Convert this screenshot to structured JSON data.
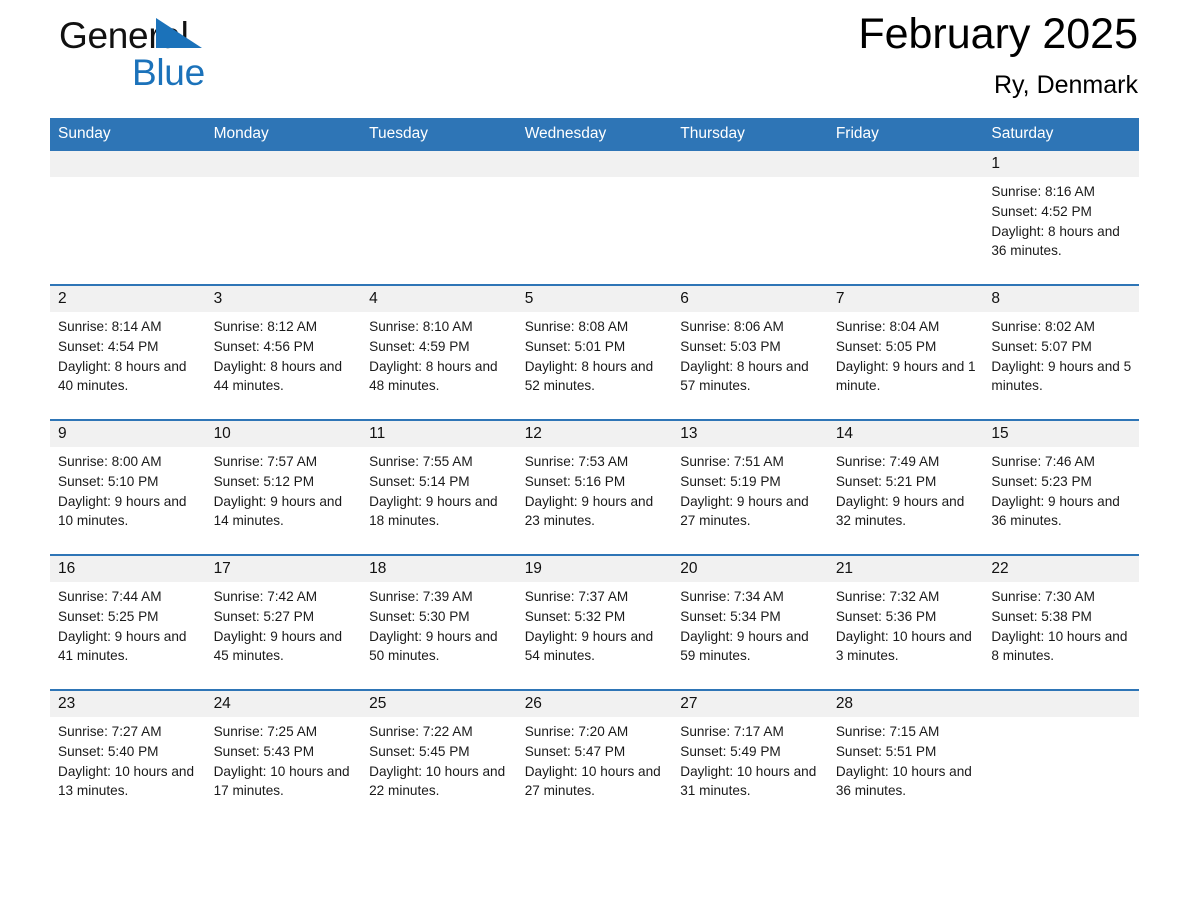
{
  "brand": {
    "name_part1": "General",
    "name_part2": "Blue",
    "accent_color": "#1b72ba"
  },
  "header": {
    "title": "February 2025",
    "subtitle": "Ry, Denmark"
  },
  "theme": {
    "header_blue": "#2e75b6",
    "daynum_band": "#f1f1f1",
    "row_border": "#2e75b6"
  },
  "weekdays": [
    "Sunday",
    "Monday",
    "Tuesday",
    "Wednesday",
    "Thursday",
    "Friday",
    "Saturday"
  ],
  "labels": {
    "sunrise_prefix": "Sunrise:",
    "sunset_prefix": "Sunset:",
    "daylight_prefix": "Daylight:"
  },
  "weeks": [
    [
      {
        "day": "",
        "sunrise": "",
        "sunset": "",
        "daylight": ""
      },
      {
        "day": "",
        "sunrise": "",
        "sunset": "",
        "daylight": ""
      },
      {
        "day": "",
        "sunrise": "",
        "sunset": "",
        "daylight": ""
      },
      {
        "day": "",
        "sunrise": "",
        "sunset": "",
        "daylight": ""
      },
      {
        "day": "",
        "sunrise": "",
        "sunset": "",
        "daylight": ""
      },
      {
        "day": "",
        "sunrise": "",
        "sunset": "",
        "daylight": ""
      },
      {
        "day": "1",
        "sunrise": "Sunrise: 8:16 AM",
        "sunset": "Sunset: 4:52 PM",
        "daylight": "Daylight: 8 hours and 36 minutes."
      }
    ],
    [
      {
        "day": "2",
        "sunrise": "Sunrise: 8:14 AM",
        "sunset": "Sunset: 4:54 PM",
        "daylight": "Daylight: 8 hours and 40 minutes."
      },
      {
        "day": "3",
        "sunrise": "Sunrise: 8:12 AM",
        "sunset": "Sunset: 4:56 PM",
        "daylight": "Daylight: 8 hours and 44 minutes."
      },
      {
        "day": "4",
        "sunrise": "Sunrise: 8:10 AM",
        "sunset": "Sunset: 4:59 PM",
        "daylight": "Daylight: 8 hours and 48 minutes."
      },
      {
        "day": "5",
        "sunrise": "Sunrise: 8:08 AM",
        "sunset": "Sunset: 5:01 PM",
        "daylight": "Daylight: 8 hours and 52 minutes."
      },
      {
        "day": "6",
        "sunrise": "Sunrise: 8:06 AM",
        "sunset": "Sunset: 5:03 PM",
        "daylight": "Daylight: 8 hours and 57 minutes."
      },
      {
        "day": "7",
        "sunrise": "Sunrise: 8:04 AM",
        "sunset": "Sunset: 5:05 PM",
        "daylight": "Daylight: 9 hours and 1 minute."
      },
      {
        "day": "8",
        "sunrise": "Sunrise: 8:02 AM",
        "sunset": "Sunset: 5:07 PM",
        "daylight": "Daylight: 9 hours and 5 minutes."
      }
    ],
    [
      {
        "day": "9",
        "sunrise": "Sunrise: 8:00 AM",
        "sunset": "Sunset: 5:10 PM",
        "daylight": "Daylight: 9 hours and 10 minutes."
      },
      {
        "day": "10",
        "sunrise": "Sunrise: 7:57 AM",
        "sunset": "Sunset: 5:12 PM",
        "daylight": "Daylight: 9 hours and 14 minutes."
      },
      {
        "day": "11",
        "sunrise": "Sunrise: 7:55 AM",
        "sunset": "Sunset: 5:14 PM",
        "daylight": "Daylight: 9 hours and 18 minutes."
      },
      {
        "day": "12",
        "sunrise": "Sunrise: 7:53 AM",
        "sunset": "Sunset: 5:16 PM",
        "daylight": "Daylight: 9 hours and 23 minutes."
      },
      {
        "day": "13",
        "sunrise": "Sunrise: 7:51 AM",
        "sunset": "Sunset: 5:19 PM",
        "daylight": "Daylight: 9 hours and 27 minutes."
      },
      {
        "day": "14",
        "sunrise": "Sunrise: 7:49 AM",
        "sunset": "Sunset: 5:21 PM",
        "daylight": "Daylight: 9 hours and 32 minutes."
      },
      {
        "day": "15",
        "sunrise": "Sunrise: 7:46 AM",
        "sunset": "Sunset: 5:23 PM",
        "daylight": "Daylight: 9 hours and 36 minutes."
      }
    ],
    [
      {
        "day": "16",
        "sunrise": "Sunrise: 7:44 AM",
        "sunset": "Sunset: 5:25 PM",
        "daylight": "Daylight: 9 hours and 41 minutes."
      },
      {
        "day": "17",
        "sunrise": "Sunrise: 7:42 AM",
        "sunset": "Sunset: 5:27 PM",
        "daylight": "Daylight: 9 hours and 45 minutes."
      },
      {
        "day": "18",
        "sunrise": "Sunrise: 7:39 AM",
        "sunset": "Sunset: 5:30 PM",
        "daylight": "Daylight: 9 hours and 50 minutes."
      },
      {
        "day": "19",
        "sunrise": "Sunrise: 7:37 AM",
        "sunset": "Sunset: 5:32 PM",
        "daylight": "Daylight: 9 hours and 54 minutes."
      },
      {
        "day": "20",
        "sunrise": "Sunrise: 7:34 AM",
        "sunset": "Sunset: 5:34 PM",
        "daylight": "Daylight: 9 hours and 59 minutes."
      },
      {
        "day": "21",
        "sunrise": "Sunrise: 7:32 AM",
        "sunset": "Sunset: 5:36 PM",
        "daylight": "Daylight: 10 hours and 3 minutes."
      },
      {
        "day": "22",
        "sunrise": "Sunrise: 7:30 AM",
        "sunset": "Sunset: 5:38 PM",
        "daylight": "Daylight: 10 hours and 8 minutes."
      }
    ],
    [
      {
        "day": "23",
        "sunrise": "Sunrise: 7:27 AM",
        "sunset": "Sunset: 5:40 PM",
        "daylight": "Daylight: 10 hours and 13 minutes."
      },
      {
        "day": "24",
        "sunrise": "Sunrise: 7:25 AM",
        "sunset": "Sunset: 5:43 PM",
        "daylight": "Daylight: 10 hours and 17 minutes."
      },
      {
        "day": "25",
        "sunrise": "Sunrise: 7:22 AM",
        "sunset": "Sunset: 5:45 PM",
        "daylight": "Daylight: 10 hours and 22 minutes."
      },
      {
        "day": "26",
        "sunrise": "Sunrise: 7:20 AM",
        "sunset": "Sunset: 5:47 PM",
        "daylight": "Daylight: 10 hours and 27 minutes."
      },
      {
        "day": "27",
        "sunrise": "Sunrise: 7:17 AM",
        "sunset": "Sunset: 5:49 PM",
        "daylight": "Daylight: 10 hours and 31 minutes."
      },
      {
        "day": "28",
        "sunrise": "Sunrise: 7:15 AM",
        "sunset": "Sunset: 5:51 PM",
        "daylight": "Daylight: 10 hours and 36 minutes."
      },
      {
        "day": "",
        "sunrise": "",
        "sunset": "",
        "daylight": ""
      }
    ]
  ]
}
